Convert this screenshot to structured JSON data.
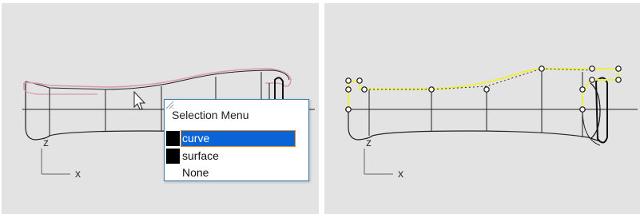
{
  "left_viewport": {
    "axes": {
      "z_label": "z",
      "x_label": "x"
    },
    "selection_menu": {
      "title": "Selection Menu",
      "items": [
        {
          "label": "curve",
          "selected": true,
          "swatch_color": "#000000"
        },
        {
          "label": "surface",
          "selected": false,
          "swatch_color": "#000000"
        },
        {
          "label": "None",
          "selected": false
        }
      ],
      "highlight_color": "#0a64d6",
      "highlight_border_color": "#e88a1a"
    },
    "highlight_curve_color": "#d4a0b0"
  },
  "right_viewport": {
    "axes": {
      "z_label": "z",
      "x_label": "x"
    },
    "selected_curve_color": "#f5f542"
  },
  "viewport_background": "#e3e3e3"
}
